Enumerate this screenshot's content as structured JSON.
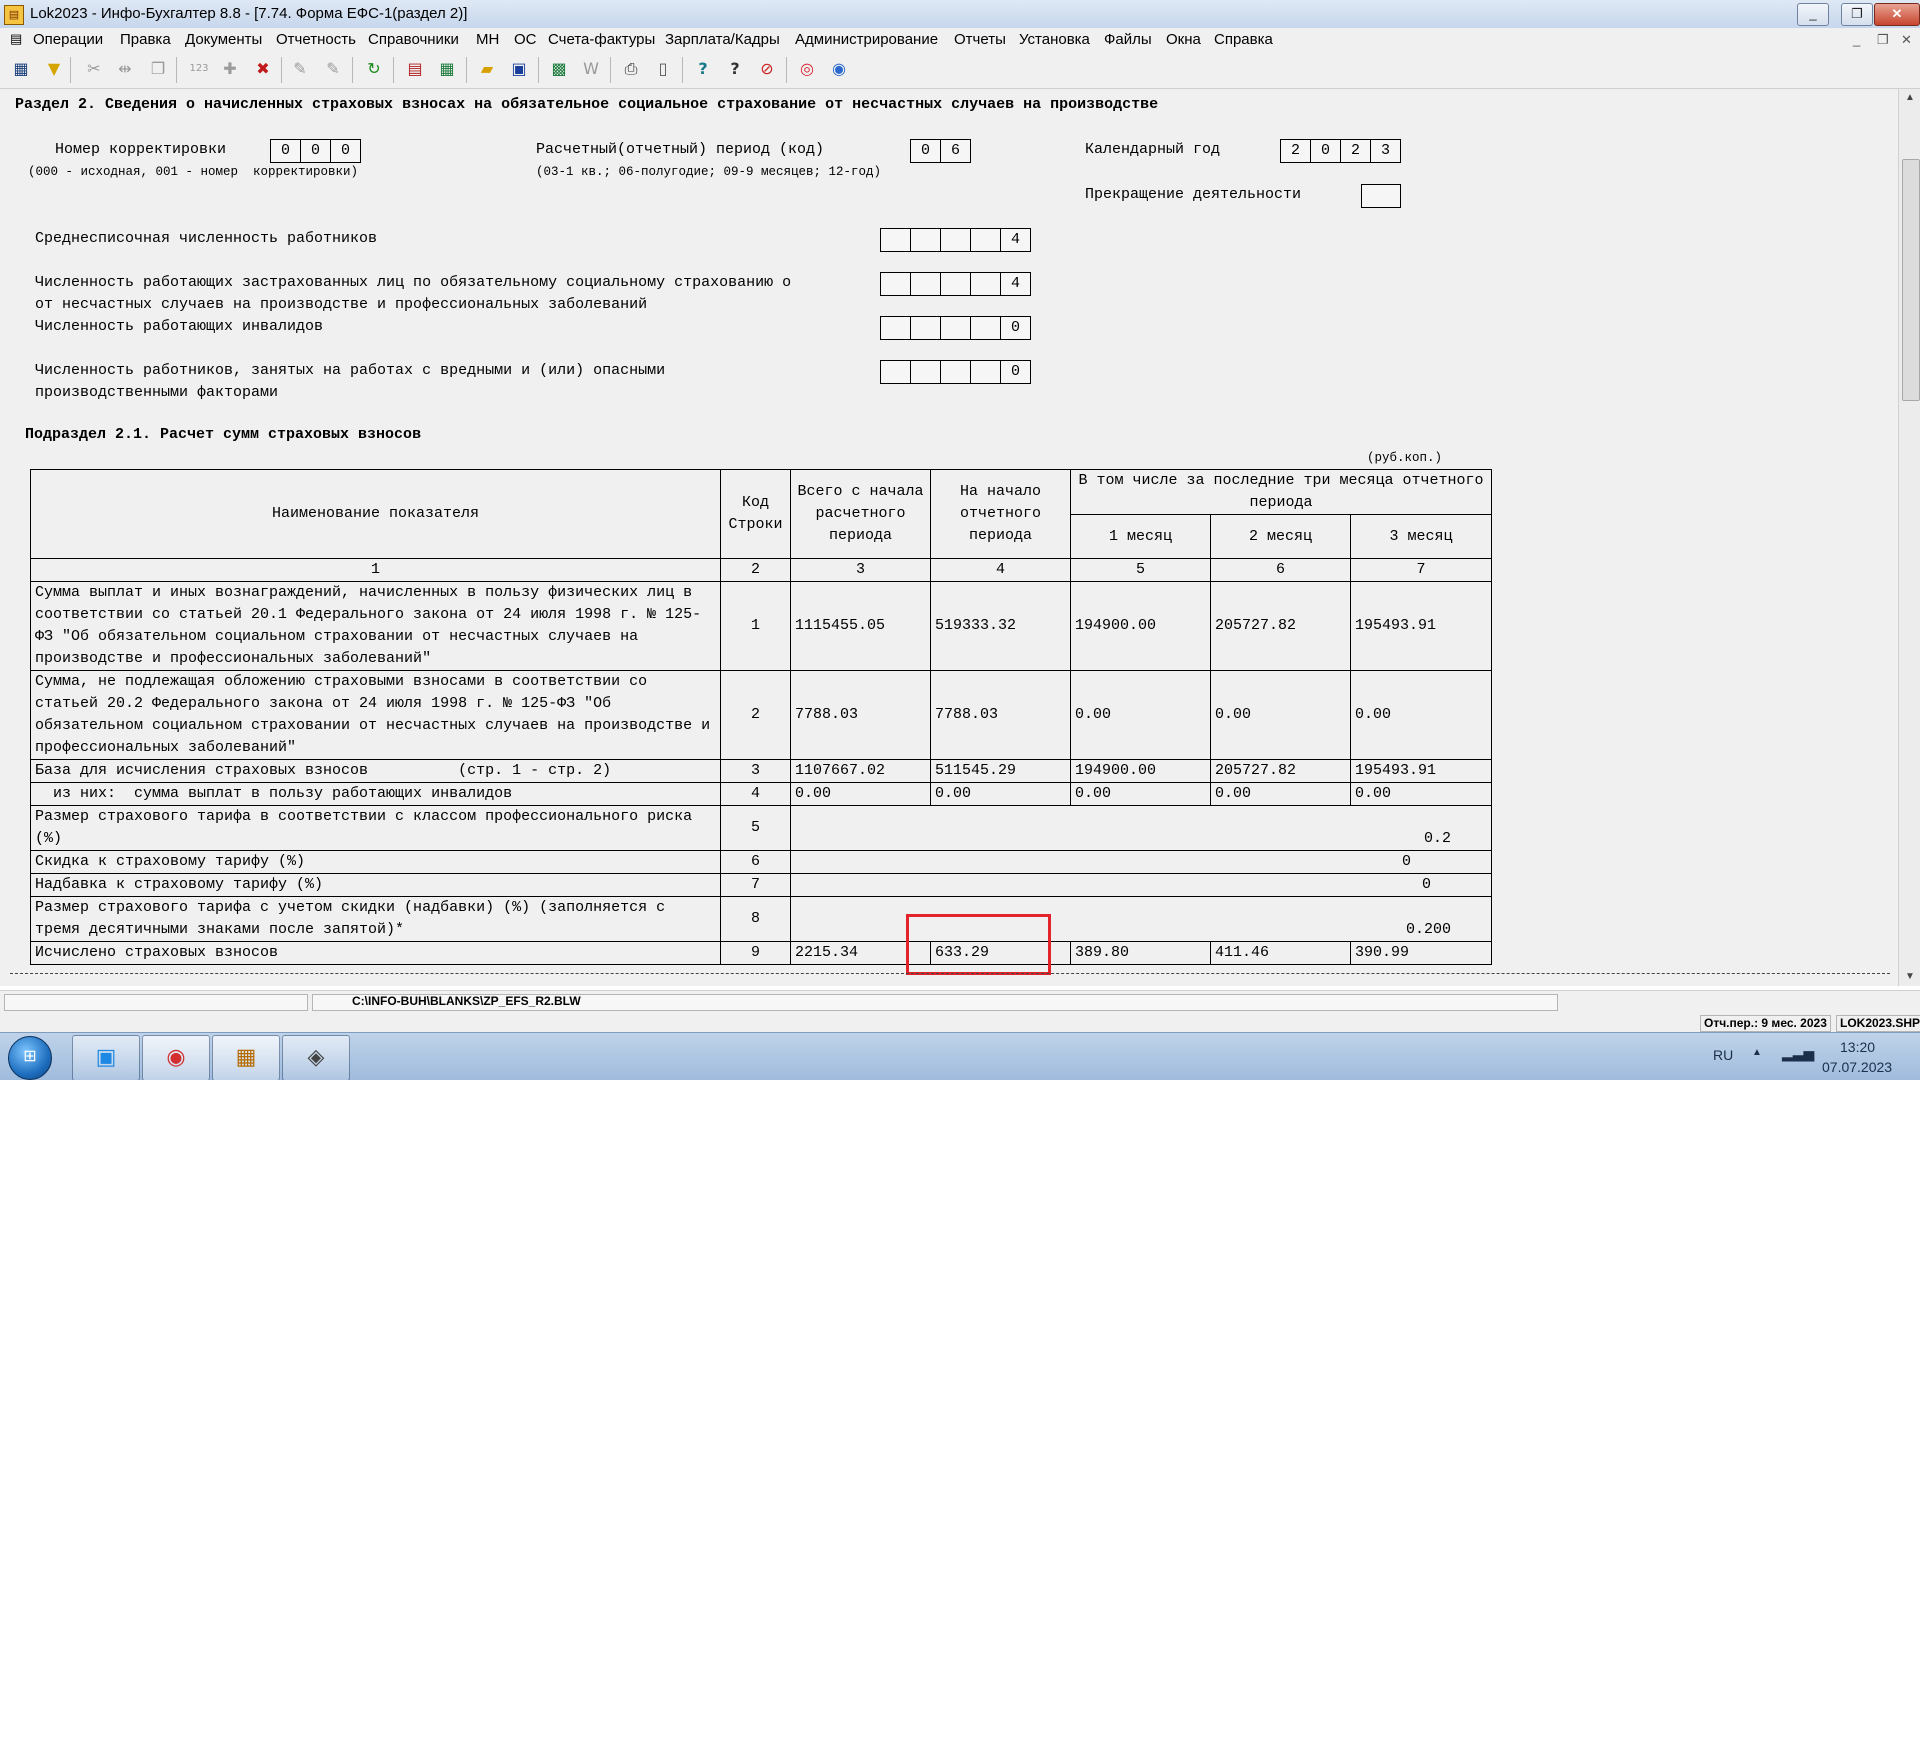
{
  "window": {
    "title": "Lok2023 - Инфо-Бухгалтер 8.8 - [7.74.    Форма ЕФС-1(раздел 2)]",
    "controls": [
      "_",
      "❐",
      "✕"
    ]
  },
  "menu": {
    "items": [
      "Операции",
      "Правка",
      "Документы",
      "Отчетность",
      "Справочники",
      "МН",
      "ОС",
      "Счета-фактуры",
      "Зарплата/Кадры",
      "Администрирование",
      "Отчеты",
      "Установка",
      "Файлы",
      "Окна",
      "Справка"
    ],
    "mdi_controls": [
      "_",
      "❐",
      "✕"
    ]
  },
  "toolbar": {
    "icons": [
      "list-icon",
      "filter-icon",
      "cut-icon",
      "split-icon",
      "copy-icon",
      "numbering-icon",
      "add-icon",
      "delete-icon",
      "edit-icon",
      "edit2-icon",
      "refresh-icon",
      "report-icon",
      "calculator-icon",
      "open-icon",
      "save-icon",
      "excel-icon",
      "word-icon",
      "print-icon",
      "preview-icon",
      "help-icon",
      "help-context-icon",
      "compass-icon",
      "support-icon",
      "web-icon"
    ]
  },
  "form": {
    "section_title": "Раздел 2. Сведения о начисленных страховых взносах на обязательное социальное страхование от несчастных случаев на производстве",
    "correction_label": "Номер корректировки",
    "correction_value": [
      "0",
      "0",
      "0"
    ],
    "correction_hint": "(000 - исходная, 001 - номер  корректировки)",
    "period_label": "Расчетный(отчетный) период (код)",
    "period_value": [
      "0",
      "6"
    ],
    "period_hint": "(03-1 кв.; 06-полугодие; 09-9 месяцев; 12-год)",
    "year_label": "Календарный год",
    "year_value": [
      "2",
      "0",
      "2",
      "3"
    ],
    "termination_label": "Прекращение деятельности",
    "termination_value": "",
    "avg_headcount_label": "Среднесписочная численность работников",
    "avg_headcount_value": "4",
    "insured_label_1": "Численность работающих застрахованных лиц по обязательному социальному страхованию о",
    "insured_label_2": "от несчастных случаев на производстве и профессиональных заболеваний",
    "insured_value": "4",
    "disabled_label": "Численность работающих инвалидов",
    "disabled_value": "0",
    "hazard_label_1": "Численность работников, занятых на работах с вредными и (или) опасными",
    "hazard_label_2": "производственными факторами",
    "hazard_value": "0",
    "subsection_title": "Подраздел 2.1. Расчет сумм страховых взносов",
    "units": "(руб.коп.)"
  },
  "table": {
    "headers": {
      "name": "Наименование показателя",
      "code": "Код Строки",
      "total": "Всего с начала расчетного периода",
      "start": "На начало отчетного периода",
      "last3": "В том числе за последние три месяца отчетного периода",
      "m1": "1 месяц",
      "m2": "2 месяц",
      "m3": "3 месяц"
    },
    "col_numbers": [
      "1",
      "2",
      "3",
      "4",
      "5",
      "6",
      "7"
    ],
    "rows": [
      {
        "name": "Сумма выплат и иных вознаграждений, начисленных в пользу физических лиц в соответствии со статьей 20.1 Федерального закона от 24 июля 1998 г. № 125-ФЗ \"Об обязательном социальном страховании от несчастных случаев на производстве и профессиональных заболеваний\"",
        "code": "1",
        "total": "1115455.05",
        "start": "519333.32",
        "m1": "194900.00",
        "m2": "205727.82",
        "m3": "195493.91"
      },
      {
        "name": "Сумма, не подлежащая обложению страховыми взносами в соответствии со статьей 20.2 Федерального закона от 24 июля 1998 г. № 125-ФЗ \"Об обязательном социальном страховании от несчастных случаев на производстве и профессиональных заболеваний\"",
        "code": "2",
        "total": "7788.03",
        "start": "7788.03",
        "m1": "0.00",
        "m2": "0.00",
        "m3": "0.00"
      },
      {
        "name": "База для исчисления страховых взносов          (стр. 1 - стр. 2)",
        "code": "3",
        "total": "1107667.02",
        "start": "511545.29",
        "m1": "194900.00",
        "m2": "205727.82",
        "m3": "195493.91"
      },
      {
        "name": "  из них:  сумма выплат в пользу работающих инвалидов",
        "code": "4",
        "total": "0.00",
        "start": "0.00",
        "m1": "0.00",
        "m2": "0.00",
        "m3": "0.00"
      },
      {
        "name": "Размер страхового тарифа в соответствии с классом профессионального риска (%)",
        "code": "5",
        "value": "0.2"
      },
      {
        "name": "Скидка к страховому тарифу (%)",
        "code": "6",
        "value": "0"
      },
      {
        "name": "Надбавка к страховому тарифу (%)",
        "code": "7",
        "value": "0"
      },
      {
        "name": "Размер страхового тарифа с учетом скидки (надбавки) (%) (заполняется с тремя десятичными знаками после запятой)*",
        "code": "8",
        "value": "0.200"
      },
      {
        "name": "Исчислено страховых взносов",
        "code": "9",
        "total": "2215.34",
        "start": "633.29",
        "m1": "389.80",
        "m2": "411.46",
        "m3": "390.99"
      }
    ]
  },
  "statusbar": {
    "path": "C:\\INFO-BUH\\BLANKS\\ZP_EFS_R2.BLW",
    "period": "Отч.пер.: 9 мес. 2023",
    "file": "LOK2023.SHP"
  },
  "taskbar": {
    "language": "RU",
    "time": "13:20",
    "date": "07.07.2023"
  }
}
